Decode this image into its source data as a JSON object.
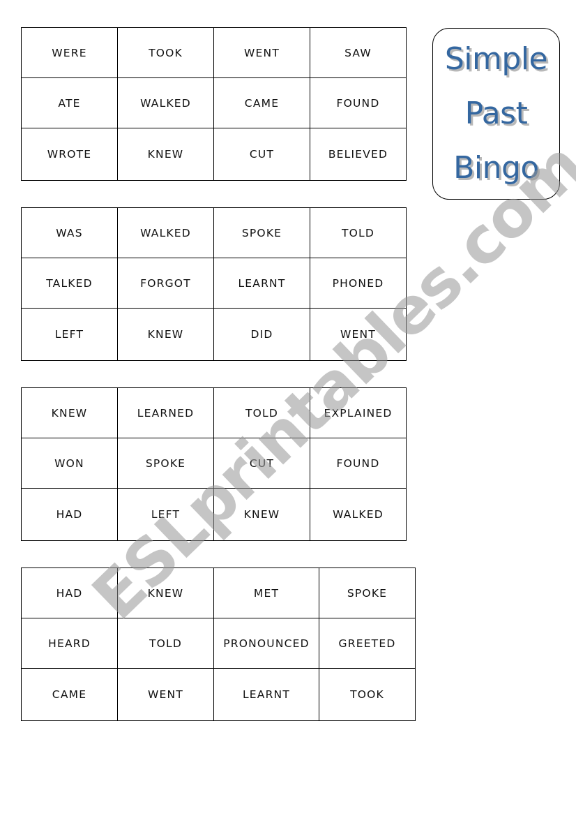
{
  "title": {
    "lines": [
      "Simple",
      "Past",
      "Bingo"
    ],
    "color": "#3467a0"
  },
  "watermark": "ESLprintables.com",
  "cards": [
    {
      "rows": [
        [
          "WERE",
          "TOOK",
          "WENT",
          "SAW"
        ],
        [
          "ATE",
          "WALKED",
          "CAME",
          "FOUND"
        ],
        [
          "WROTE",
          "KNEW",
          "CUT",
          "BELIEVED"
        ]
      ]
    },
    {
      "rows": [
        [
          "WAS",
          "WALKED",
          "SPOKE",
          "TOLD"
        ],
        [
          "TALKED",
          "FORGOT",
          "LEARNT",
          "PHONED"
        ],
        [
          "LEFT",
          "KNEW",
          "DID",
          "WENT"
        ]
      ]
    },
    {
      "rows": [
        [
          "KNEW",
          "LEARNED",
          "TOLD",
          "EXPLAINED"
        ],
        [
          "WON",
          "SPOKE",
          "CUT",
          "FOUND"
        ],
        [
          "HAD",
          "LEFT",
          "KNEW",
          "WALKED"
        ]
      ]
    },
    {
      "rows": [
        [
          "HAD",
          "KNEW",
          "MET",
          "SPOKE"
        ],
        [
          "HEARD",
          "TOLD",
          "PRONOUNCED",
          "GREETED"
        ],
        [
          "CAME",
          "WENT",
          "LEARNT",
          "TOOK"
        ]
      ]
    }
  ]
}
